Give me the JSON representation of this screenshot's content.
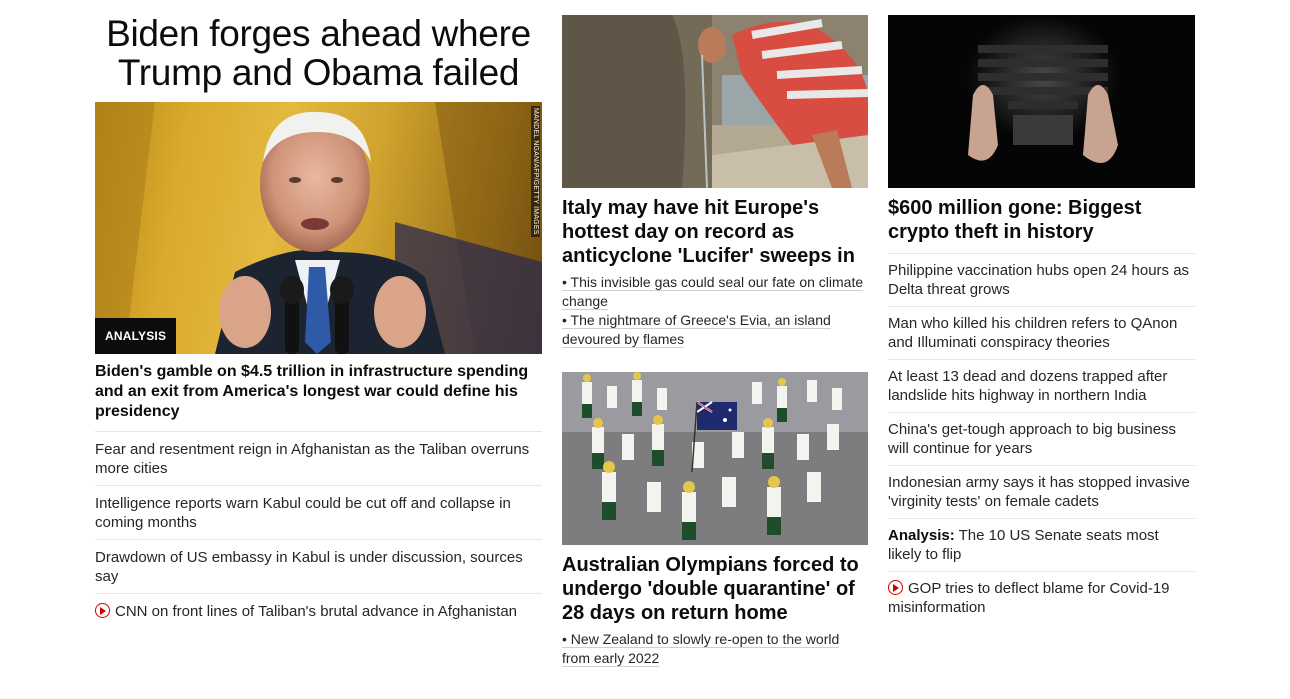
{
  "left": {
    "banner": "Biden forges ahead where Trump and Obama failed",
    "hero_badge": "ANALYSIS",
    "hero_credit": "MANDEL NGAN/AFP/GETTY IMAGES",
    "lead_headline": "Biden's gamble on $4.5 trillion in infrastructure spending and an exit from America's longest war could define his presidency",
    "links": [
      "Fear and resentment reign in Afghanistan as the Taliban overruns more cities",
      "Intelligence reports warn Kabul could be cut off and collapse in coming months",
      "Drawdown of US embassy in Kabul is under discussion, sources say",
      "CNN on front lines of Taliban's brutal advance in Afghanistan"
    ]
  },
  "middle": {
    "story1": {
      "headline": "Italy may have hit Europe's hottest day on record as anticyclone 'Lucifer' sweeps in",
      "bullets": [
        "• This invisible gas could seal our fate on climate change",
        "• The nightmare of Greece's Evia, an island devoured by flames"
      ]
    },
    "story2": {
      "headline": "Australian Olympians forced to undergo 'double quarantine' of 28 days on return home",
      "bullets": [
        "• New Zealand to slowly re-open to the world from early 2022"
      ]
    }
  },
  "right": {
    "headline": "$600 million gone: Biggest crypto theft in history",
    "links": [
      "Philippine vaccination hubs open 24 hours as Delta threat grows",
      "Man who killed his children refers to QAnon and Illuminati conspiracy theories",
      "At least 13 dead and dozens trapped after landslide hits highway in northern India",
      "China's get-tough approach to big business will continue for years",
      "Indonesian army says it has stopped invasive 'virginity tests' on female cadets"
    ],
    "analysis_label": "Analysis:",
    "analysis_text": " The 10 US Senate seats most likely to flip",
    "video_link": "GOP tries to deflect blame for Covid-19 misinformation"
  },
  "colors": {
    "accent_red": "#cc0000",
    "text": "#0c0c0c",
    "divider": "#e6e6e6"
  },
  "icons": {
    "video": "play-circle-icon"
  }
}
